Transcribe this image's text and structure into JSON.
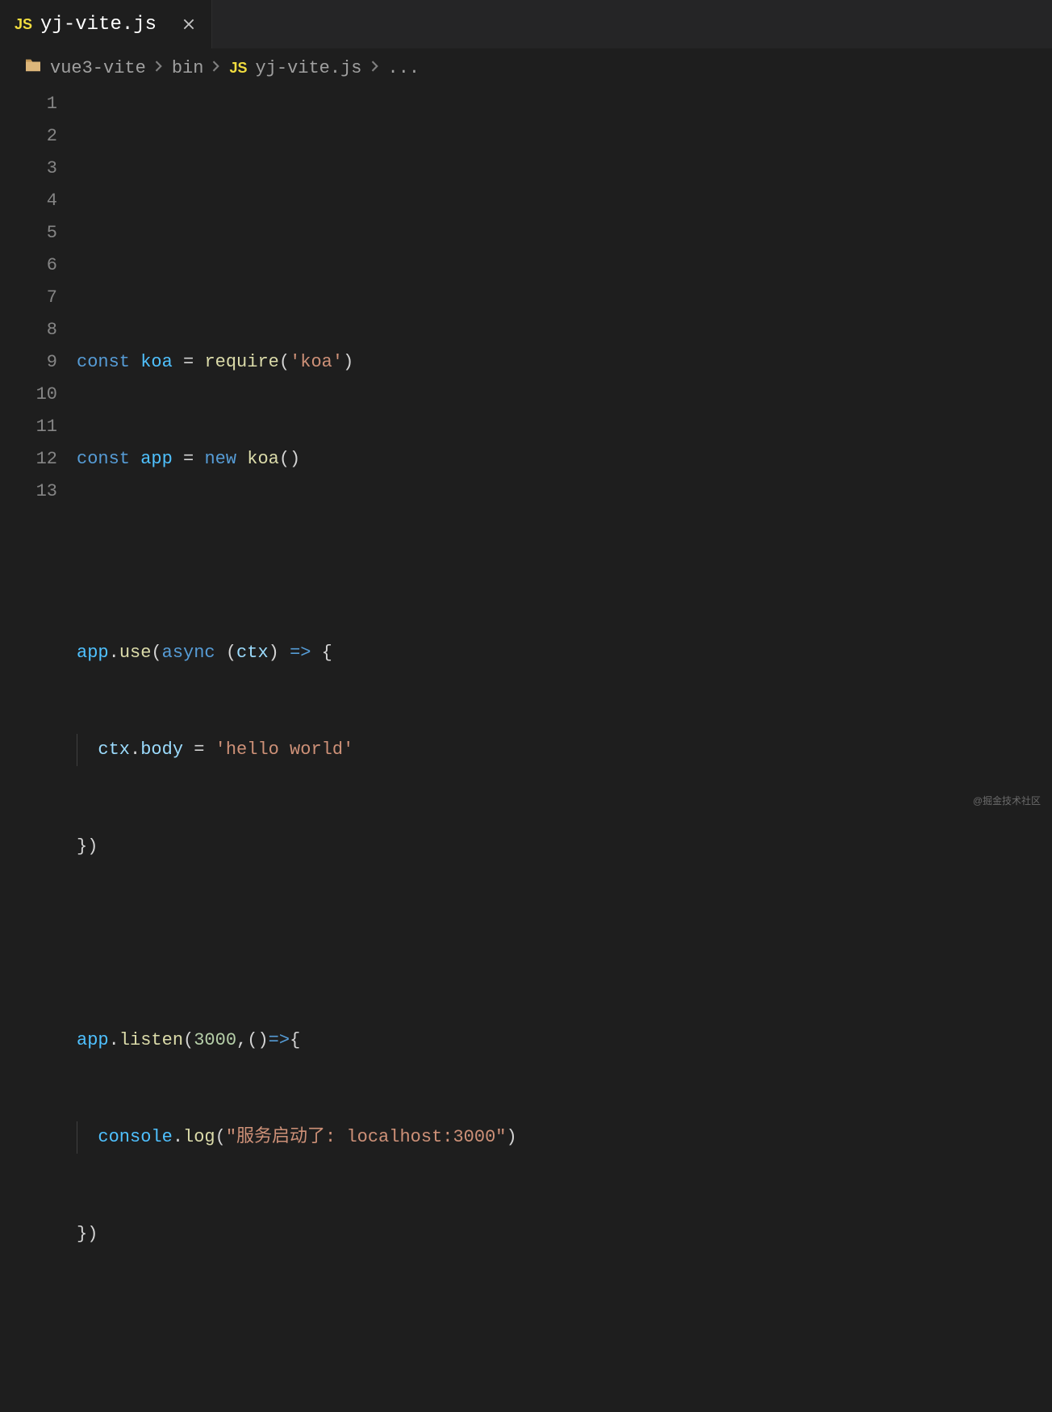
{
  "tab": {
    "icon_label": "JS",
    "filename": "yj-vite.js"
  },
  "breadcrumb": {
    "segments": [
      "vue3-vite",
      "bin"
    ],
    "file_icon": "JS",
    "filename": "yj-vite.js",
    "more": "..."
  },
  "gutter": {
    "lines": [
      "1",
      "2",
      "3",
      "4",
      "5",
      "6",
      "7",
      "8",
      "9",
      "10",
      "11",
      "12",
      "13"
    ]
  },
  "code": {
    "line3": {
      "const": "const",
      "var": "koa",
      "eq": " = ",
      "func": "require",
      "open": "(",
      "str": "'koa'",
      "close": ")"
    },
    "line4": {
      "const": "const",
      "var": "app",
      "eq": " = ",
      "new": "new",
      "ctor": "koa",
      "parens": "()"
    },
    "line6": {
      "obj": "app",
      "dot": ".",
      "method": "use",
      "open": "(",
      "async": "async",
      "popen": " (",
      "param": "ctx",
      "pclose": ") ",
      "arrow": "=>",
      "brace": " {"
    },
    "line7": {
      "indent": "  ",
      "obj": "ctx",
      "dot": ".",
      "prop": "body",
      "eq": " = ",
      "str": "'hello world'"
    },
    "line8": {
      "close": "})"
    },
    "line10": {
      "obj": "app",
      "dot": ".",
      "method": "listen",
      "open": "(",
      "num": "3000",
      "comma": ",",
      "parens": "()",
      "arrow": "=>",
      "brace": "{"
    },
    "line11": {
      "indent": "  ",
      "obj": "console",
      "dot": ".",
      "method": "log",
      "open": "(",
      "str": "\"服务启动了: localhost:3000\"",
      "close": ")"
    },
    "line12": {
      "close": "})"
    }
  },
  "watermark": "@掘金技术社区"
}
